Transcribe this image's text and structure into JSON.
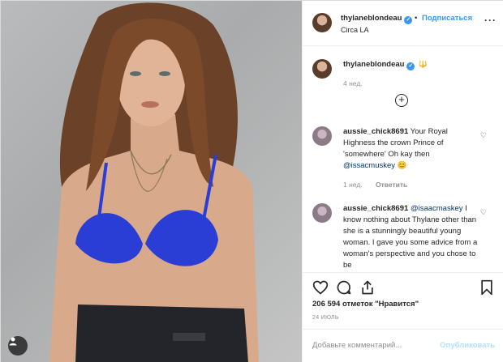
{
  "post": {
    "username": "thylaneblondeau",
    "follow_label": "Подписаться",
    "separator": "•",
    "location": "Circa LA",
    "more_icon": "more-icon"
  },
  "caption": {
    "username": "thylaneblondeau",
    "emoji": "🔱",
    "time": "4 нед."
  },
  "comments": [
    {
      "username": "aussie_chick8691",
      "text": "Your Royal Highness the crown Prince of 'somewhere' Oh kay then",
      "mention": "@issacmuskey",
      "emoji": "😊",
      "time": "1 нед.",
      "reply_label": "Ответить"
    },
    {
      "username": "aussie_chick8691",
      "mention": "@isaacmaskey",
      "text": "I know nothing about Thylane other than she is a stunningly beautiful young woman. I gave you some advice from a woman's perspective and you chose to be"
    }
  ],
  "actions": {
    "likes": "206 594 отметок \"Нравится\"",
    "date": "24 ИЮЛЬ",
    "add_comment_placeholder": "Добавьте комментарий...",
    "post_label": "Опубликовать"
  },
  "colors": {
    "accent": "#3897f0",
    "swimsuit": "#2a3ed6",
    "muted": "#8e8e8e"
  }
}
